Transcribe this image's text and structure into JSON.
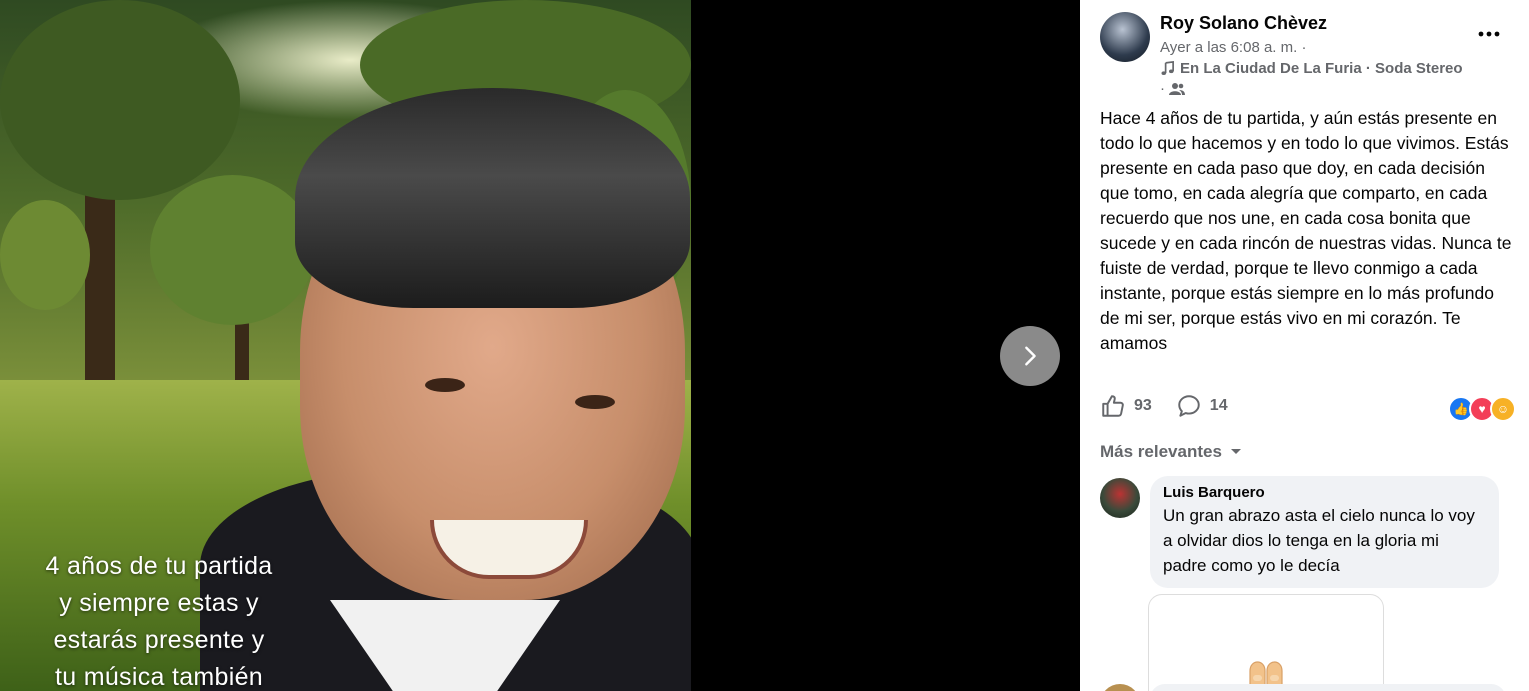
{
  "viewer": {
    "overlay_lines": [
      "4 años de tu partida",
      "y siempre estas y",
      "estarás presente y",
      "tu música también"
    ]
  },
  "post": {
    "author": "Roy Solano Chèvez",
    "timestamp": "Ayer a las 6:08 a. m.",
    "song": "En La Ciudad De La Furia · Soda Stereo",
    "audience": "·",
    "text": "Hace 4 años de tu partida, y aún estás presente en todo lo que hacemos y en todo lo que vivimos. Estás presente en cada paso que doy, en cada decisión que tomo, en cada alegría que comparto, en cada recuerdo que nos une, en cada cosa bonita que sucede y en cada rincón de nuestras vidas. Nunca te fuiste de verdad, porque te llevo conmigo a cada instante, porque estás siempre en lo más profundo de mi ser, porque estás vivo en mi corazón. Te amamos",
    "likes": "93",
    "comments": "14"
  },
  "comments_section": {
    "sort_label": "Más relevantes",
    "comments": [
      {
        "author": "Luis Barquero",
        "text": "Un gran abrazo asta el cielo nunca lo voy a olvidar dios lo tenga en la gloria mi padre como yo le decía"
      }
    ]
  },
  "colors": {
    "secondary_text": "#65676b",
    "primary_text": "#050505",
    "like_blue": "#1877f2",
    "love_red": "#f33e58",
    "bubble_bg": "#f0f2f5"
  }
}
